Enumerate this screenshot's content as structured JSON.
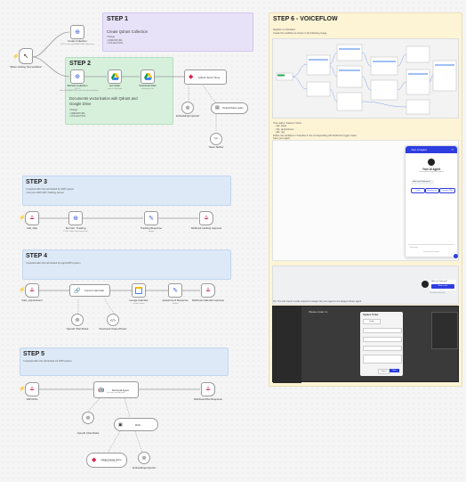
{
  "colors": {
    "accent": "#ff6d5a",
    "step_purple": "#e7e2f7",
    "step_green": "#d6f0dc",
    "step_blue": "#dde9f7",
    "step_yellow": "#fdf4d6"
  },
  "step1": {
    "title": "STEP 1",
    "subtitle": "Create Qdrant Collection",
    "lines": [
      "Change",
      "• QDRANTURL",
      "• COLLECTION"
    ]
  },
  "step2": {
    "title": "STEP 2",
    "subtitle": "Documents vectorization with Qdrant and Google Drive",
    "lines": [
      "Change",
      "• QDRANTURL",
      "• COLLECTION"
    ]
  },
  "step3": {
    "title": "STEP 3",
    "desc": "It required after the call started by VAPI system",
    "sub": "• Set your VAPI URL Tracking service"
  },
  "step4": {
    "title": "STEP 4",
    "desc": "It required after the call started by Agent/VAPI system"
  },
  "step5": {
    "title": "STEP 5",
    "desc": "It required after the call started via VAPI system"
  },
  "step6": {
    "title": "STEP 6 - VOICEFLOW",
    "lines": [
      "Register on Voiceflow",
      "Create the workflow as shown in the following image"
    ],
    "notes": [
      "Then add a \"Capture\" block:",
      "- title: ticket",
      "- title: appointment",
      "- title: rag",
      "Define the variables in Voiceflow in the corresponding API Webhook trigger nodes",
      "Save your agent",
      "Test your prompt",
      "Publish your agent",
      "In the Widget section, choose the look & copy the installation script"
    ],
    "bottom_note": "Tip: You can import a code snippet to assign into your agent to be always shown agent"
  },
  "chat": {
    "header": "Your AI agent",
    "agent_name": "Your AI agent",
    "agent_desc": "Description of your AI agent",
    "greeting": "How can I help you?",
    "buttons": [
      "Ticket",
      "Appointment",
      "Question RAG"
    ],
    "input_placeholder": "Message...",
    "powered": "Powered by Voiceflow"
  },
  "chat_small": {
    "line1": "How can I help you?",
    "button": "Start a chat",
    "powered": "Powered by Voiceflow"
  },
  "editor": {
    "title": "Please Listen to",
    "dialog_title": "Capture Ticket",
    "dialog_tab": "Entity",
    "save": "Save",
    "cancel": "Cancel"
  },
  "nodes": {
    "trigger": {
      "label": "\"When clicking Test workflow\""
    },
    "create_collection": {
      "label": "Create Collection",
      "sub": "POST: https://QDRANTURL/collections"
    },
    "refresh_collection": {
      "label": "Refresh Collection",
      "sub": "POST: https://QDRANTURL/collections/points/delete"
    },
    "get_folder": {
      "label": "Get folder",
      "sub": "search: fileFolder"
    },
    "download_files": {
      "label": "Download Files",
      "sub": "download: file"
    },
    "qdrant_store": {
      "label": "Qdrant Vector Store"
    },
    "embeddings": {
      "label": "Embeddings OpenAI"
    },
    "doc_loader": {
      "label": "Default Data Loader"
    },
    "text_splitter": {
      "label": "Token Splitter"
    },
    "call_vapi": {
      "label": "Call_Vapi"
    },
    "set_call_tracking": {
      "label": "Set Call - Tracking",
      "sub": "POST: https://api.vapi.ai/call"
    },
    "tracking_response": {
      "label": "Tracking Response",
      "sub": "update"
    },
    "webhook_tracking": {
      "label": "Webhook tracking response"
    },
    "gain_appointment": {
      "label": "Gain_Appointment"
    },
    "convert_date": {
      "label": "Convert start date"
    },
    "google_calendar": {
      "label": "Google Calendar",
      "sub": "create: event"
    },
    "appointment_response": {
      "label": "Appointment Response",
      "sub": "update"
    },
    "webhook_appointment": {
      "label": "Webhook Calendar response"
    },
    "openai_chat": {
      "label": "OpenAI Chat Model"
    },
    "structured_parser": {
      "label": "Structured Output Parser"
    },
    "vapi_rag": {
      "label": "VAPI RAG"
    },
    "retrieval_agent": {
      "label": "Retrieval Agent",
      "sub": "Question and Answer"
    },
    "webhook_rag": {
      "label": "Webhook RAG Response"
    },
    "openai_chat2": {
      "label": "OpenAI Chat Model"
    },
    "rag_tool": {
      "label": "RAG"
    },
    "qdrant_store2": {
      "label": "Qdrant Vector Store",
      "sub": "Retrieve Qdrant"
    },
    "embeddings2": {
      "label": "Embeddings OpenAI"
    }
  }
}
